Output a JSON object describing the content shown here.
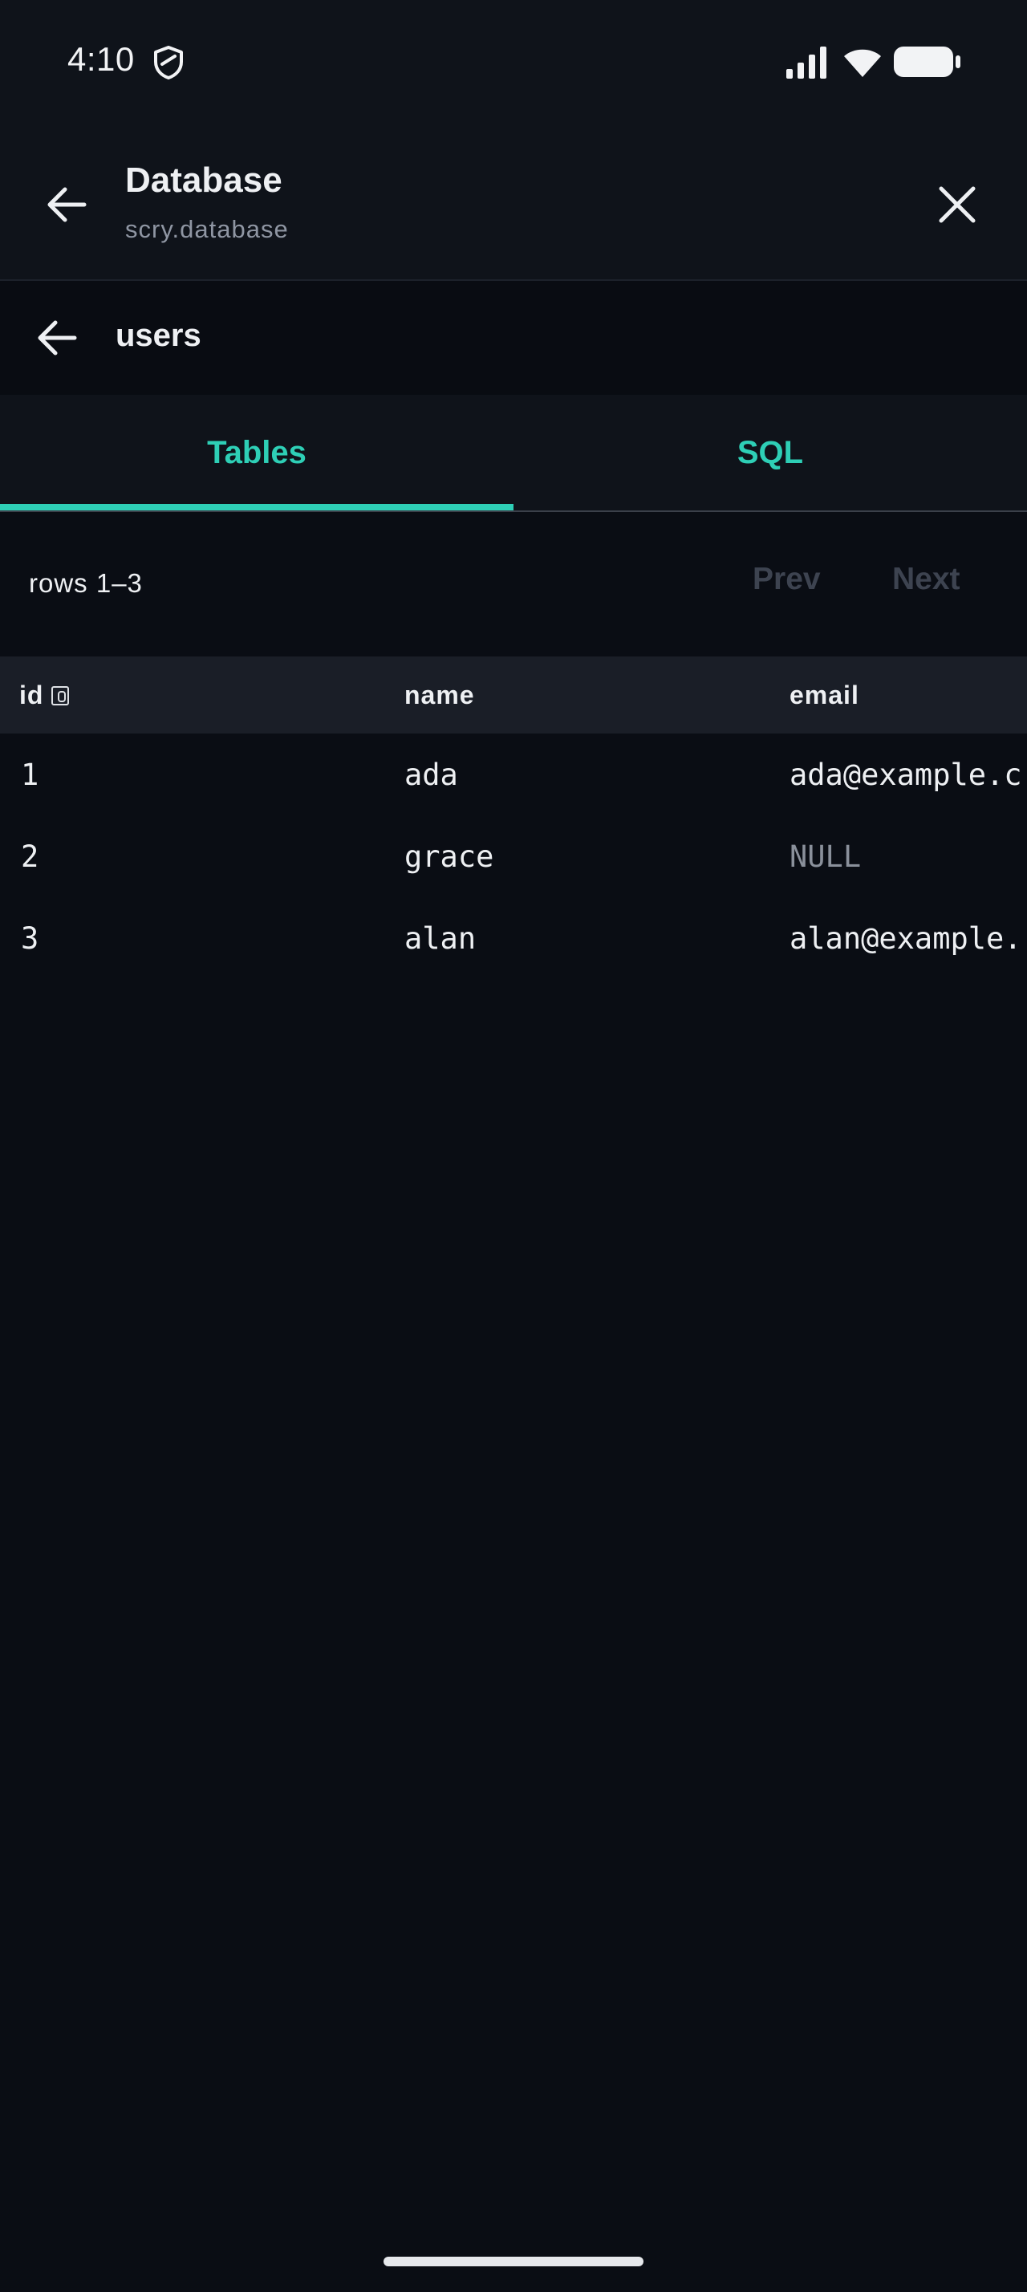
{
  "status_bar": {
    "time": "4:10",
    "icons": [
      "shield-icon",
      "signal-icon",
      "wifi-icon",
      "battery-icon"
    ]
  },
  "app_bar": {
    "title": "Database",
    "subtitle": "scry.database",
    "back_icon": "arrow-left-icon",
    "close_icon": "close-icon"
  },
  "table_bar": {
    "back_icon": "arrow-left-icon",
    "table_name": "users"
  },
  "tabs": [
    {
      "label": "Tables",
      "selected": true
    },
    {
      "label": "SQL",
      "selected": false
    }
  ],
  "pager": {
    "rows_label": "rows 1–3",
    "prev_label": "Prev",
    "next_label": "Next",
    "prev_enabled": false,
    "next_enabled": false
  },
  "grid": {
    "columns": [
      {
        "label": "id",
        "primary_key": true,
        "key_icon": "key-icon"
      },
      {
        "label": "name",
        "primary_key": false
      },
      {
        "label": "email",
        "primary_key": false
      }
    ],
    "rows": [
      {
        "id": "1",
        "name": "ada",
        "email": "ada@example.c"
      },
      {
        "id": "2",
        "name": "grace",
        "email": "NULL"
      },
      {
        "id": "3",
        "name": "alan",
        "email": "alan@example."
      }
    ]
  },
  "colors": {
    "accent": "#2ecfb6",
    "background": "#0a0d14",
    "surface": "#0f131a",
    "header_row": "#1a1e27",
    "muted": "#8f96a3",
    "disabled": "#3d4350"
  }
}
